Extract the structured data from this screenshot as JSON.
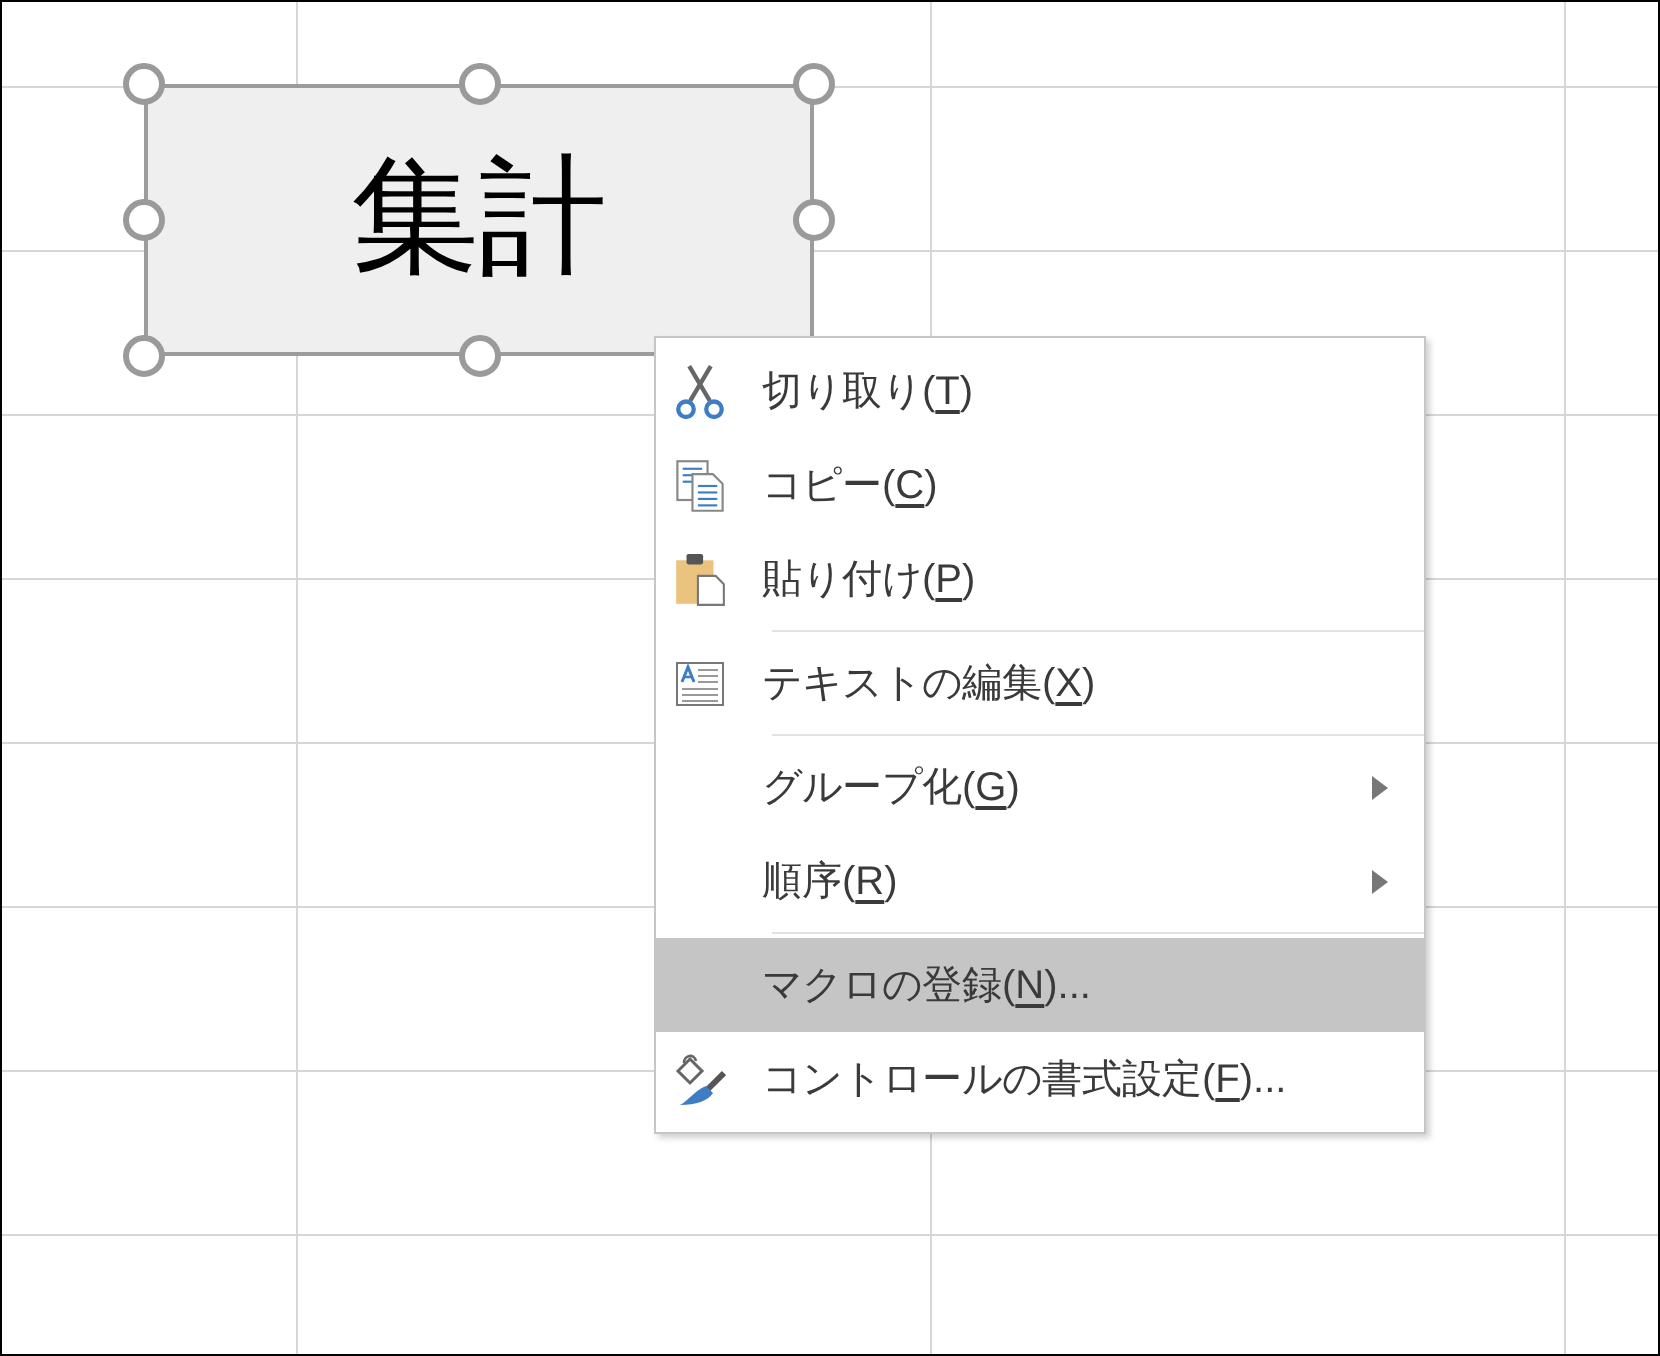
{
  "sheet": {
    "form_button": {
      "label": "集計",
      "selected": true
    }
  },
  "context_menu": {
    "groups": [
      {
        "items": [
          {
            "label": "切り取り(",
            "access_key": "T",
            "label_after": ")",
            "has_submenu": false,
            "selected": false
          },
          {
            "label": "コピー(",
            "access_key": "C",
            "label_after": ")",
            "has_submenu": false,
            "selected": false
          },
          {
            "label": "貼り付け(",
            "access_key": "P",
            "label_after": ")",
            "has_submenu": false,
            "selected": false
          }
        ]
      },
      {
        "items": [
          {
            "label": "テキストの編集(",
            "access_key": "X",
            "label_after": ")",
            "has_submenu": false,
            "selected": false
          }
        ]
      },
      {
        "items": [
          {
            "label": "グループ化(",
            "access_key": "G",
            "label_after": ")",
            "has_submenu": true,
            "selected": false
          },
          {
            "label": "順序(",
            "access_key": "R",
            "label_after": ")",
            "has_submenu": true,
            "selected": false
          }
        ]
      },
      {
        "items": [
          {
            "label": "マクロの登録(",
            "access_key": "N",
            "label_after": ")...",
            "has_submenu": false,
            "selected": true
          },
          {
            "label": "コントロールの書式設定(",
            "access_key": "F",
            "label_after": ")...",
            "has_submenu": false,
            "selected": false
          }
        ]
      }
    ]
  }
}
